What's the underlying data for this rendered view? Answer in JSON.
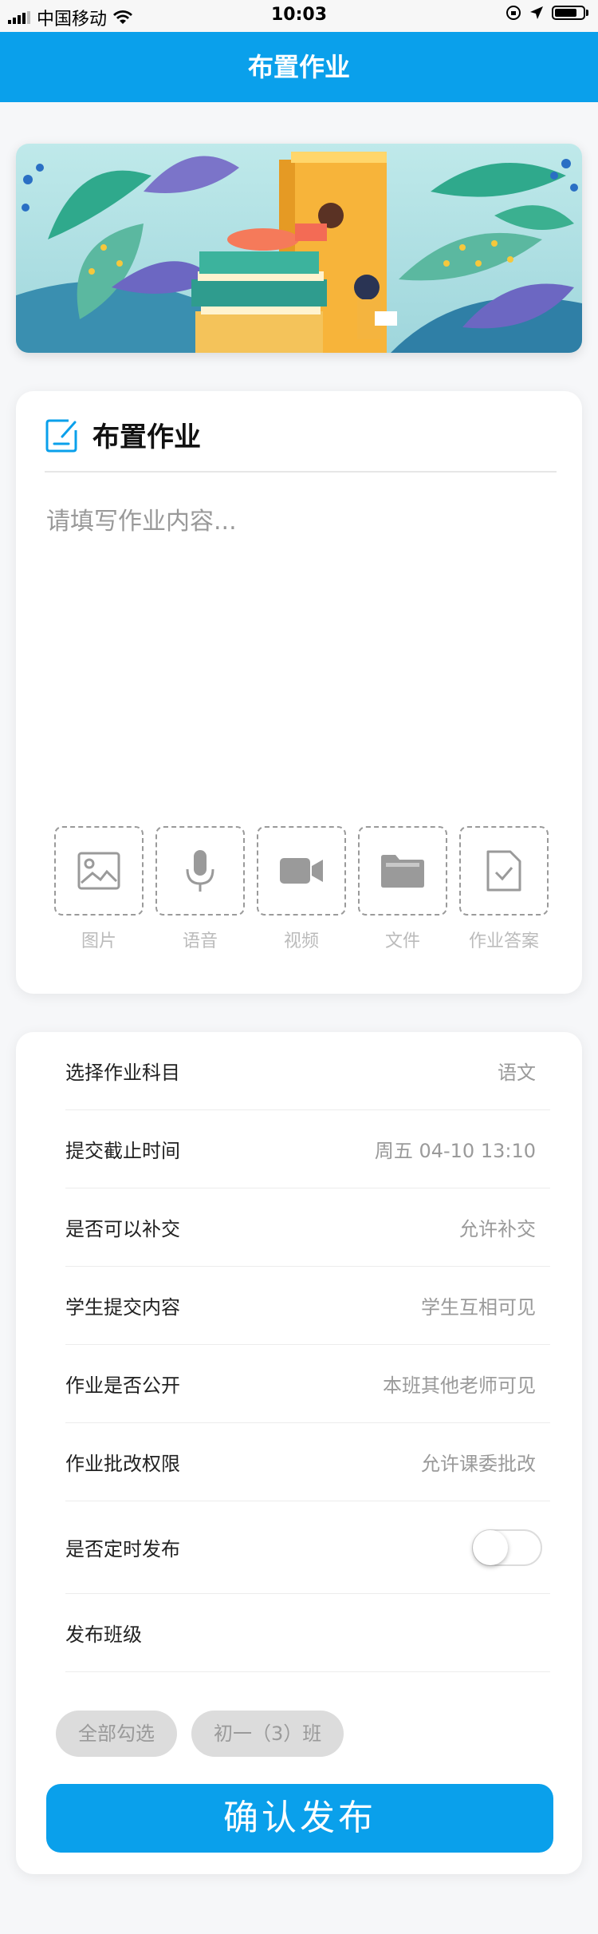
{
  "status_bar": {
    "carrier": "中国移动",
    "time": "10:03"
  },
  "nav": {
    "title": "布置作业"
  },
  "homework_card": {
    "title": "布置作业",
    "placeholder": "请填写作业内容...",
    "attachments": [
      {
        "label": "图片",
        "icon": "image-icon"
      },
      {
        "label": "语音",
        "icon": "microphone-icon"
      },
      {
        "label": "视频",
        "icon": "video-camera-icon"
      },
      {
        "label": "文件",
        "icon": "folder-icon"
      },
      {
        "label": "作业答案",
        "icon": "answer-document-icon"
      }
    ]
  },
  "settings": {
    "rows": [
      {
        "label": "选择作业科目",
        "value": "语文"
      },
      {
        "label": "提交截止时间",
        "value": "周五 04-10 13:10"
      },
      {
        "label": "是否可以补交",
        "value": "允许补交"
      },
      {
        "label": "学生提交内容",
        "value": "学生互相可见"
      },
      {
        "label": "作业是否公开",
        "value": "本班其他老师可见"
      },
      {
        "label": "作业批改权限",
        "value": "允许课委批改"
      }
    ],
    "scheduled_publish": {
      "label": "是否定时发布",
      "on": false
    },
    "publish_class": {
      "label": "发布班级"
    },
    "class_chips": [
      "全部勾选",
      "初一（3）班"
    ],
    "submit_label": "确认发布"
  },
  "colors": {
    "brand": "#0aa0eb",
    "background": "#f6f7f9"
  }
}
